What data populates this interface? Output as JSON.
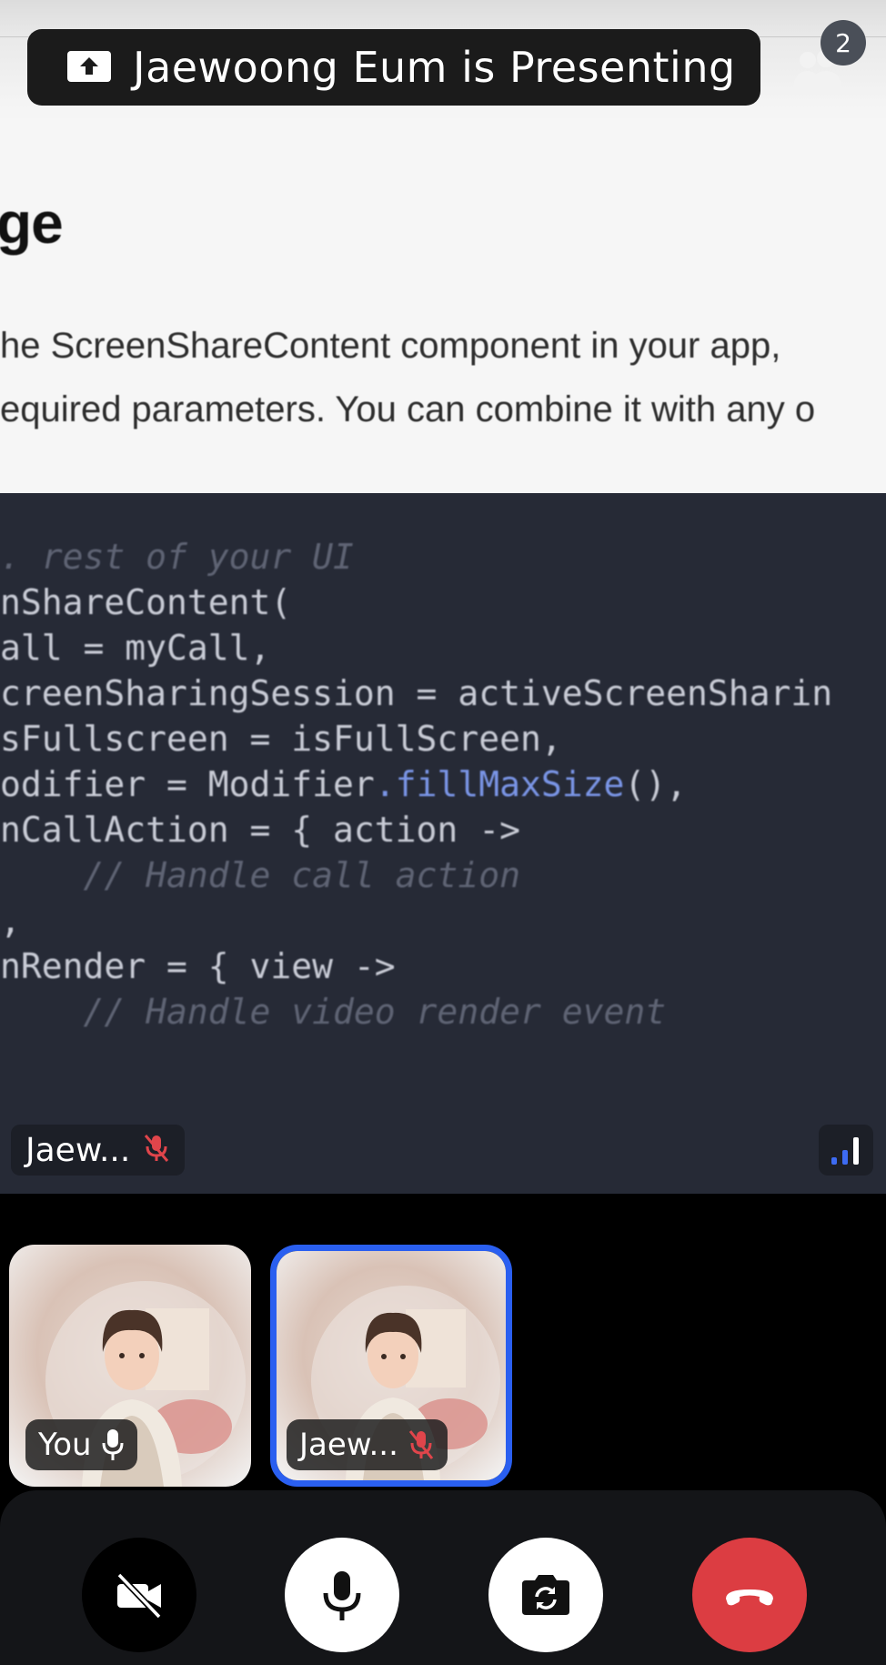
{
  "banner": {
    "text": "Jaewoong Eum is Presenting",
    "icon": "screen-share-icon"
  },
  "participants": {
    "count": "2",
    "icon": "people-icon"
  },
  "shared_screen": {
    "heading": "ge",
    "paragraph_lines": [
      "he ScreenShareContent component in your app,",
      "equired parameters. You can combine it with any o"
    ],
    "code_lines": [
      ". rest of your UI",
      "nShareContent(",
      "all = myCall,",
      "creenSharingSession = activeScreenSharin",
      "sFullscreen = isFullScreen,",
      "odifier = Modifier.fillMaxSize(),",
      "nCallAction = { action ->",
      "    // Handle call action",
      ",",
      "nRender = { view ->",
      "    // Handle video render event"
    ],
    "presenter_label": "Jaew...",
    "presenter_mic_icon": "mic-off-icon",
    "network_icon": "network-quality-icon"
  },
  "tiles": {
    "you": {
      "label": "You",
      "mic_icon": "mic-icon"
    },
    "remote": {
      "label": "Jaew...",
      "mic_icon": "mic-off-icon"
    }
  },
  "controls": {
    "video": "video-off-icon",
    "mic": "mic-icon",
    "flip": "flip-camera-icon",
    "hangup": "hang-up-icon"
  },
  "colors": {
    "accent": "#2a5ff0",
    "hangup": "#dc3d42",
    "code_bg": "#262a36",
    "muted_red": "#e0454b"
  }
}
